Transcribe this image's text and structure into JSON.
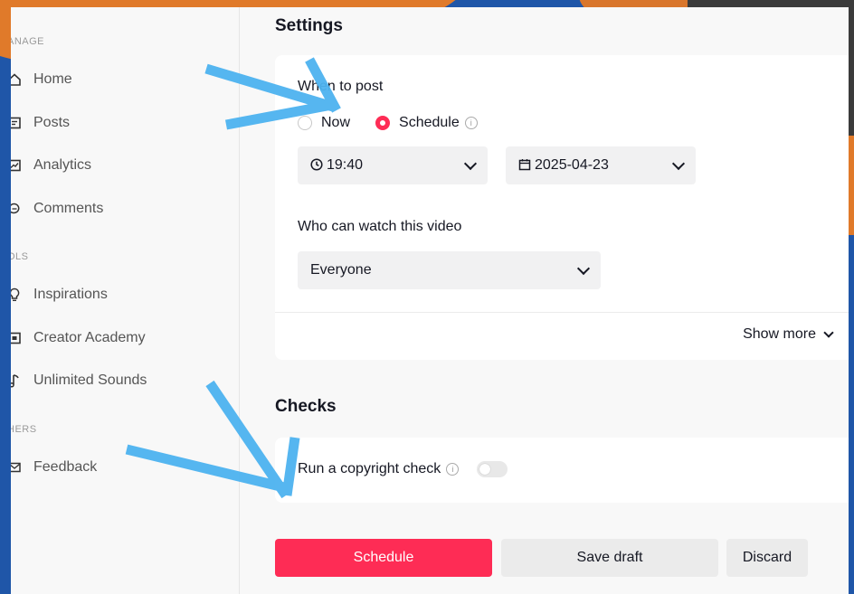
{
  "sidebar": {
    "sections": {
      "manage": "ANAGE",
      "tools": "OLS",
      "others": "HERS"
    },
    "items": [
      {
        "label": "Home",
        "icon": "home-icon"
      },
      {
        "label": "Posts",
        "icon": "posts-icon"
      },
      {
        "label": "Analytics",
        "icon": "analytics-icon"
      },
      {
        "label": "Comments",
        "icon": "comments-icon"
      },
      {
        "label": "Inspirations",
        "icon": "lightbulb-icon"
      },
      {
        "label": "Creator Academy",
        "icon": "academy-icon"
      },
      {
        "label": "Unlimited Sounds",
        "icon": "music-note-icon"
      },
      {
        "label": "Feedback",
        "icon": "mail-icon"
      }
    ]
  },
  "settings": {
    "title": "Settings",
    "when_to_post": {
      "label": "When to post",
      "options": [
        "Now",
        "Schedule"
      ],
      "selected": "Schedule"
    },
    "time": "19:40",
    "date": "2025-04-23",
    "who_can_watch": {
      "label": "Who can watch this video",
      "value": "Everyone"
    },
    "show_more": "Show more"
  },
  "checks": {
    "title": "Checks",
    "copyright_label": "Run a copyright check",
    "copyright_enabled": false
  },
  "actions": {
    "schedule": "Schedule",
    "save_draft": "Save draft",
    "discard": "Discard"
  },
  "colors": {
    "accent": "#fe2c55",
    "annotation": "#4db3f0"
  }
}
